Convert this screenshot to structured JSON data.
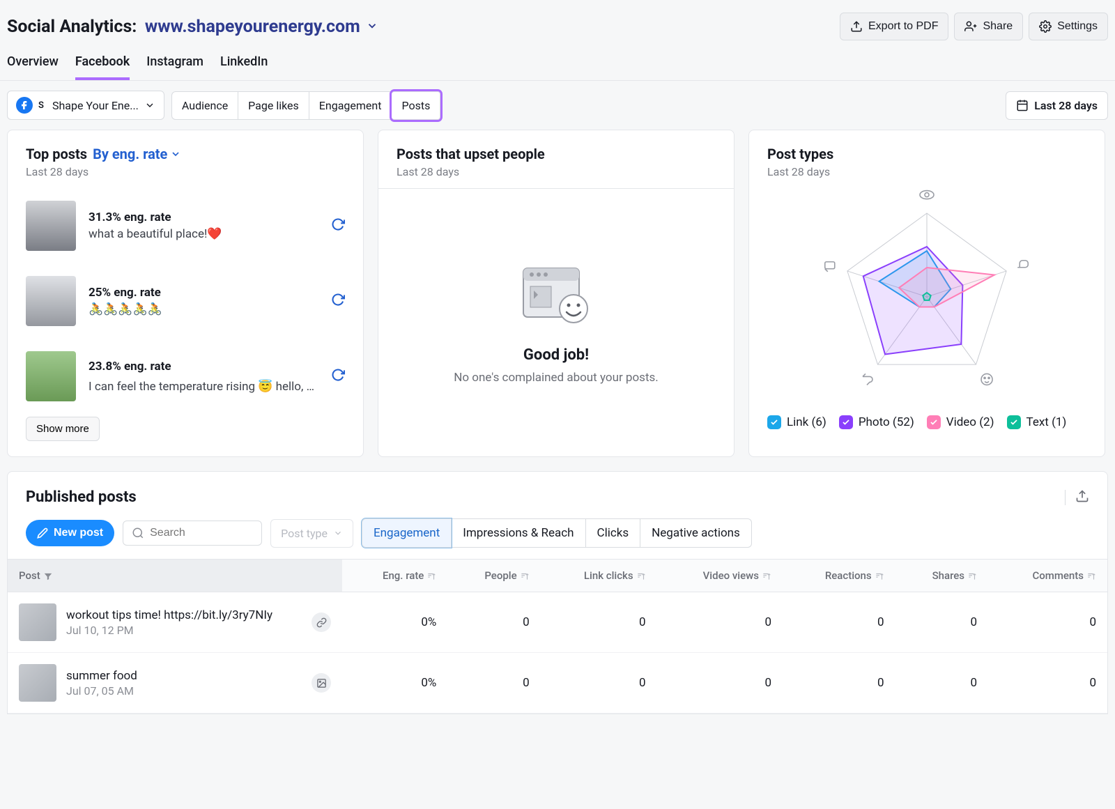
{
  "header": {
    "title": "Social Analytics:",
    "domain": "www.shapeyourenergy.com",
    "export": "Export to PDF",
    "share": "Share",
    "settings": "Settings"
  },
  "main_tabs": [
    "Overview",
    "Facebook",
    "Instagram",
    "LinkedIn"
  ],
  "main_tab_active": 1,
  "account_name": "Shape Your Ene...",
  "sub_tabs": [
    "Audience",
    "Page likes",
    "Engagement",
    "Posts"
  ],
  "sub_tab_highlight": 3,
  "date_range": "Last 28 days",
  "top_posts": {
    "title": "Top posts",
    "sort_label": "By eng. rate",
    "subtitle": "Last 28 days",
    "items": [
      {
        "rate": "31.3% eng. rate",
        "text": "what a beautiful place!❤️"
      },
      {
        "rate": "25% eng. rate",
        "text": "🚴🚴🚴🚴🚴"
      },
      {
        "rate": "23.8% eng. rate",
        "text": "I can feel the temperature rising 😇 hello, July！"
      }
    ],
    "show_more": "Show more"
  },
  "upset": {
    "title": "Posts that upset people",
    "subtitle": "Last 28 days",
    "good_title": "Good job!",
    "good_sub": "No one's complained about your posts."
  },
  "post_types": {
    "title": "Post types",
    "subtitle": "Last 28 days",
    "legend": [
      {
        "label": "Link (6)",
        "color": "blue"
      },
      {
        "label": "Photo (52)",
        "color": "purple"
      },
      {
        "label": "Video (2)",
        "color": "pink"
      },
      {
        "label": "Text (1)",
        "color": "teal"
      }
    ]
  },
  "chart_data": {
    "type": "radar",
    "axes": [
      "views",
      "reactions",
      "comments",
      "shares",
      "likes"
    ],
    "series": [
      {
        "name": "Link",
        "color": "#1ca7ea",
        "values": [
          0.55,
          0.3,
          0.15,
          0.15,
          0.6
        ]
      },
      {
        "name": "Photo",
        "color": "#8a3ffc",
        "values": [
          0.6,
          0.45,
          0.7,
          0.85,
          0.8
        ]
      },
      {
        "name": "Video",
        "color": "#ff7eb6",
        "values": [
          0.35,
          0.85,
          0.15,
          0.15,
          0.35
        ]
      },
      {
        "name": "Text",
        "color": "#0dbf9a",
        "values": [
          0.05,
          0.05,
          0.05,
          0.05,
          0.05
        ]
      }
    ],
    "scale": [
      0,
      1
    ]
  },
  "published": {
    "title": "Published posts",
    "new_post": "New post",
    "search_placeholder": "Search",
    "post_type_label": "Post type",
    "metrics": [
      "Engagement",
      "Impressions & Reach",
      "Clicks",
      "Negative actions"
    ],
    "metric_active": 0,
    "columns": [
      "Post",
      "Eng. rate",
      "People",
      "Link clicks",
      "Video views",
      "Reactions",
      "Shares",
      "Comments"
    ],
    "rows": [
      {
        "title": "workout tips time! https://bit.ly/3ry7NIy",
        "date": "Jul 10, 12 PM",
        "badge": "link",
        "eng": "0%",
        "people": "0",
        "clicks": "0",
        "views": "0",
        "reactions": "0",
        "shares": "0",
        "comments": "0"
      },
      {
        "title": "summer food",
        "date": "Jul 07, 05 AM",
        "badge": "image",
        "eng": "0%",
        "people": "0",
        "clicks": "0",
        "views": "0",
        "reactions": "0",
        "shares": "0",
        "comments": "0"
      }
    ]
  }
}
